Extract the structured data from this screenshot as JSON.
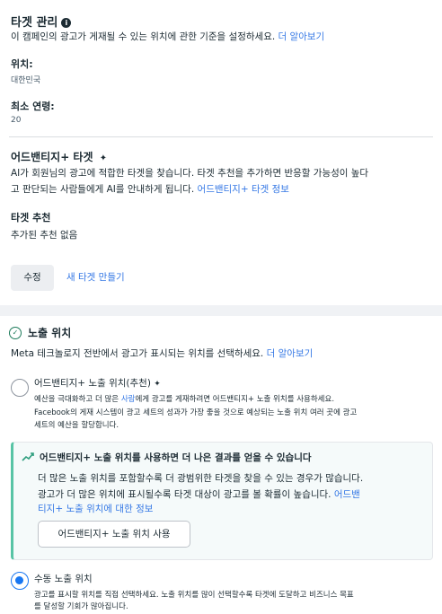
{
  "targeting": {
    "title": "타겟 관리",
    "info_glyph": "i",
    "description": "이 캠페인의 광고가 게재될 수 있는 위치에 관한 기준을 설정하세요.",
    "learn_more": "더 알아보기",
    "location_label": "위치:",
    "location_value": "대한민국",
    "min_age_label": "최소 연령:",
    "min_age_value": "20"
  },
  "advantage_audience": {
    "title": "어드밴티지+ 타겟",
    "sparkle_icon": "✦",
    "desc_line1": "AI가 회원님의 광고에 적합한 타겟을 찾습니다. 타겟 추천을 추가하면 반응할 가능성이 높다",
    "desc_line2": "고 판단되는 사람들에게 AI를 안내하게 됩니다.",
    "info_link": "어드밴티지+ 타겟 정보",
    "suggestion_label": "타겟 추천",
    "suggestion_value": "추가된 추천 없음"
  },
  "actions": {
    "edit_label": "수정",
    "new_audience_label": "새 타겟 만들기"
  },
  "placements": {
    "title": "노출 위치",
    "check_glyph": "✓",
    "description": "Meta 테크놀로지 전반에서 광고가 표시되는 위치를 선택하세요.",
    "learn_more": "더 알아보기",
    "advantage_option_label": "어드밴티지+ 노출 위치(추천)",
    "advantage_option_sparkle": "✦",
    "advantage_desc1_pre": "예산을 극대화하고 더 많은",
    "advantage_desc1_link": "사람",
    "advantage_desc1_post": "에게 광고를 게재하려면 어드밴티지+ 노출 위치를 사용하세요.",
    "advantage_desc2": "Facebook의 게재 시스템이 광고 세트의 성과가 가장 좋을 것으로 예상되는 노출 위치 여러 곳에 광고",
    "advantage_desc3": "세트의 예산을 할당합니다.",
    "promo_title": "어드밴티지+ 노출 위치를 사용하면 더 나은 결과를 얻을 수 있습니다",
    "promo_line1": "더 많은 노출 위치를 포함할수록 더 광범위한 타겟을 찾을 수 있는 경우가 많습니다.",
    "promo_line2_text": "광고가 더 많은 위치에 표시될수록 타겟 대상이 광고를 볼 확률이 높습니다.",
    "promo_line2_link": "어드밴",
    "promo_line3_link": "티지+ 노출 위치에 대한 정보",
    "promo_button": "어드밴티지+ 노출 위치 사용",
    "manual_option_label": "수동 노출 위치",
    "manual_desc1": "광고를 표시할 위치를 직접 선택하세요. 노출 위치를 많이 선택할수록 타겟에 도달하고 비즈니스 목표",
    "manual_desc2": "를 달성할 기회가 많아집니다."
  },
  "colors": {
    "accent": "#1877f2",
    "link": "#3578e5",
    "promo_border": "#58c4a5",
    "page_bg": "#f0f2f5"
  }
}
